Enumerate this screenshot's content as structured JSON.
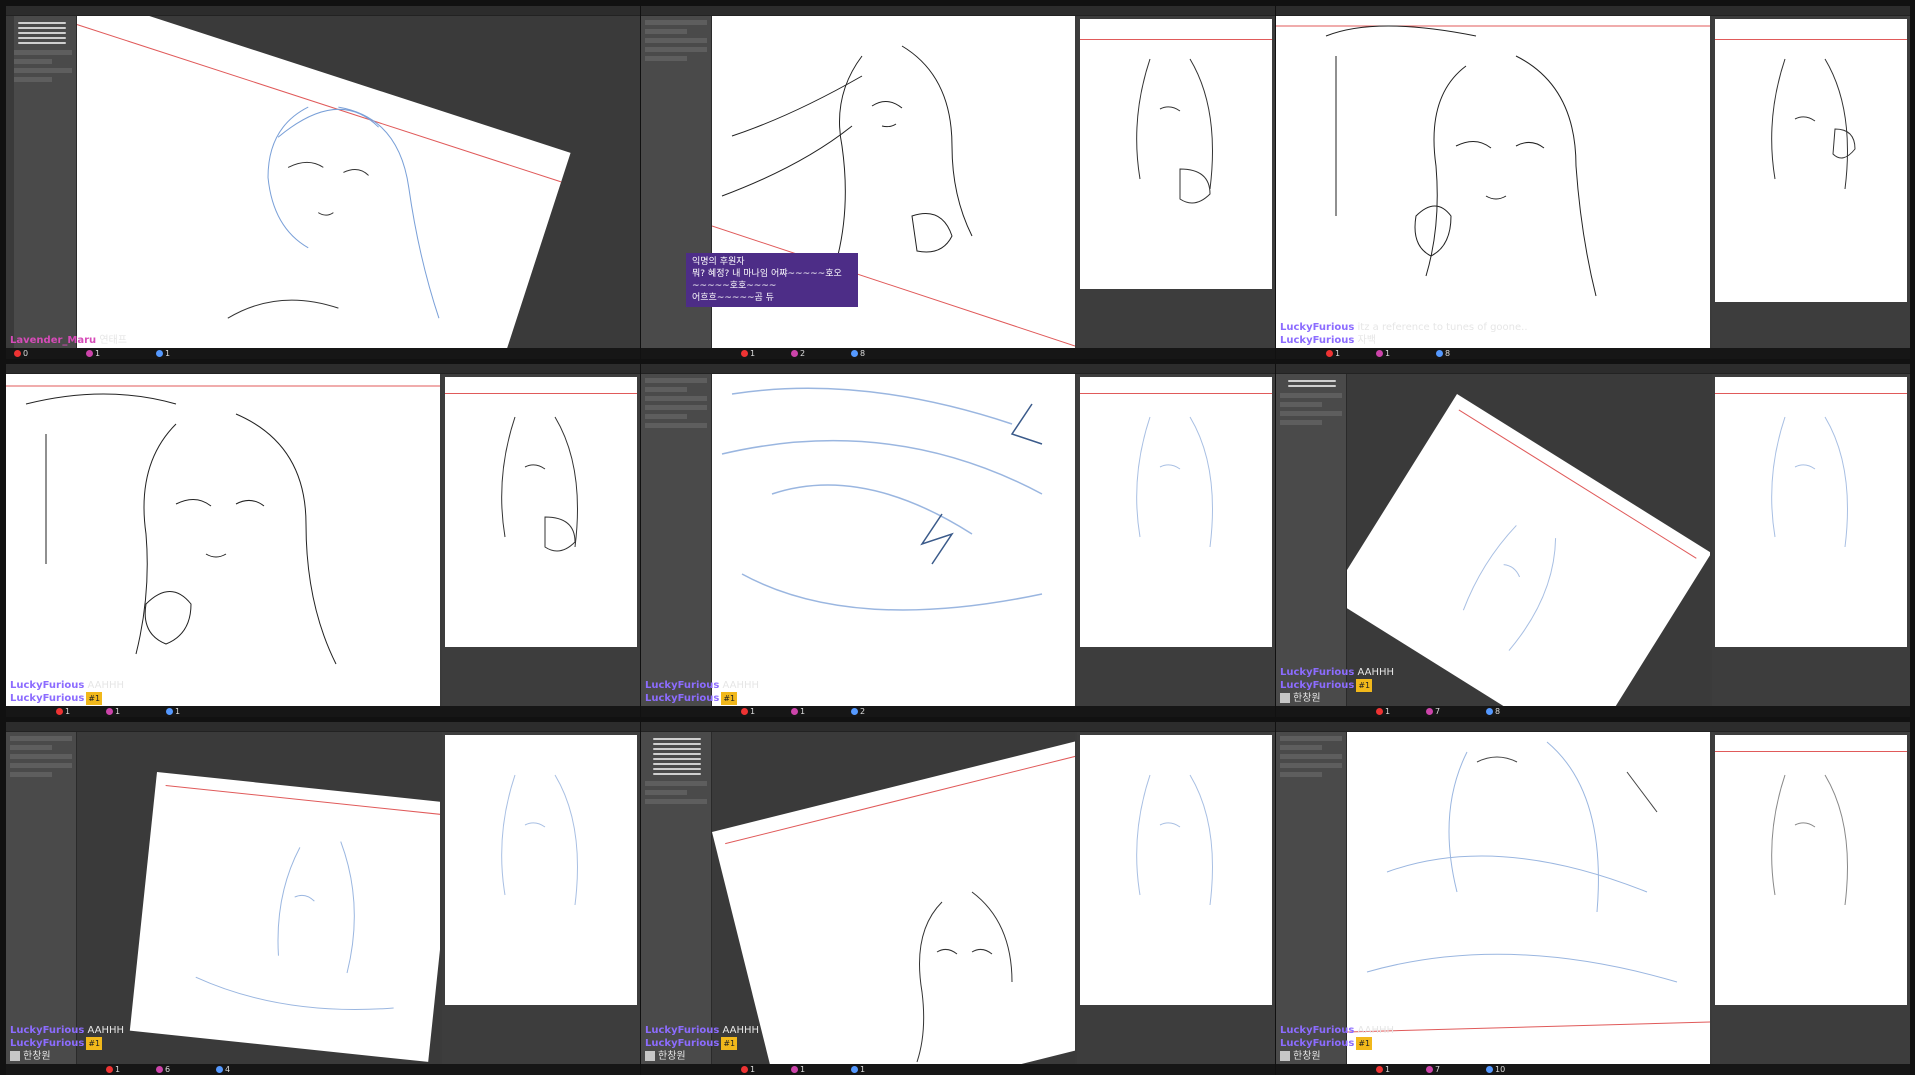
{
  "chat": {
    "p1": [
      {
        "user": "Lavender_Maru",
        "msg": "연태프"
      }
    ],
    "p2_donation": {
      "title": "익명의 후원자",
      "line1": "뭐? 혜정? 내 마나임 어쨔~~~~~호오~~~~~호호~~~~",
      "line2": "어흐흐~~~~~곰 듀"
    },
    "p3": [
      {
        "user": "LuckyFurious",
        "msg": "itz a reference to tunes of goone.."
      },
      {
        "user": "LuckyFurious",
        "msg": "자백"
      }
    ],
    "p4": [
      {
        "user": "LuckyFurious",
        "msg": "AAHHH"
      },
      {
        "user": "LuckyFurious",
        "msg": "",
        "badge": "#1"
      }
    ],
    "p5": [
      {
        "user": "LuckyFurious",
        "msg": "AAHHH"
      },
      {
        "user": "LuckyFurious",
        "msg": "",
        "badge": "#1"
      }
    ],
    "p6": [
      {
        "user": "LuckyFurious",
        "msg": "AAHHH"
      },
      {
        "user": "LuckyFurious",
        "msg": "",
        "badge": "#1"
      },
      {
        "user": "",
        "msg": "한창원"
      }
    ],
    "p7": [
      {
        "user": "LuckyFurious",
        "msg": "AAHHH"
      },
      {
        "user": "LuckyFurious",
        "msg": "",
        "badge": "#1"
      },
      {
        "user": "",
        "msg": "한창원"
      }
    ],
    "p8": [
      {
        "user": "LuckyFurious",
        "msg": "AAHHH"
      },
      {
        "user": "LuckyFurious",
        "msg": "",
        "badge": "#1"
      },
      {
        "user": "",
        "msg": "한창원"
      }
    ],
    "p9": [
      {
        "user": "LuckyFurious",
        "msg": "AAHHH"
      },
      {
        "user": "LuckyFurious",
        "msg": "",
        "badge": "#1"
      },
      {
        "user": "",
        "msg": "한창원"
      }
    ]
  },
  "stats": {
    "p1": [
      "0",
      "1",
      "1"
    ],
    "p2": [
      "1",
      "2",
      "8"
    ],
    "p3": [
      "1",
      "1",
      "8"
    ],
    "p4": [
      "1",
      "1",
      "1"
    ],
    "p5": [
      "1",
      "1",
      "2"
    ],
    "p6": [
      "1",
      "7",
      "8"
    ],
    "p7": [
      "1",
      "6",
      "4"
    ],
    "p8": [
      "1",
      "1",
      "1"
    ],
    "p9": [
      "1",
      "7",
      "10"
    ]
  },
  "colors": {
    "accent": "#8c6cff",
    "donation": "#4d2d87",
    "guide": "#e05a5a",
    "badge": "#f1b81b"
  }
}
